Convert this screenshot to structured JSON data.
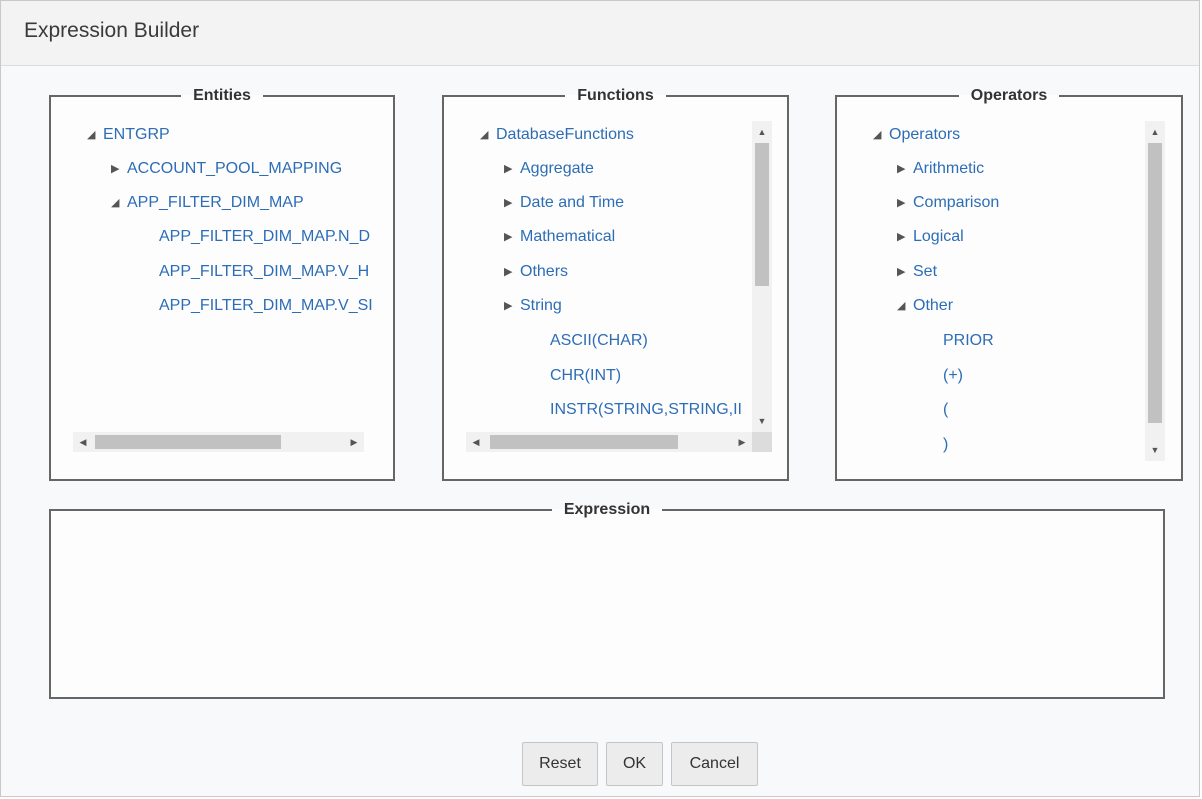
{
  "dialog": {
    "title": "Expression Builder"
  },
  "entities": {
    "legend": "Entities",
    "nodes": [
      {
        "label": "ENTGRP",
        "state": "open"
      },
      {
        "label": "ACCOUNT_POOL_MAPPING",
        "state": "closed"
      },
      {
        "label": "APP_FILTER_DIM_MAP",
        "state": "open"
      },
      {
        "label": "APP_FILTER_DIM_MAP.N_D"
      },
      {
        "label": "APP_FILTER_DIM_MAP.V_H"
      },
      {
        "label": "APP_FILTER_DIM_MAP.V_SI"
      }
    ]
  },
  "functions": {
    "legend": "Functions",
    "nodes": [
      {
        "label": "DatabaseFunctions",
        "state": "open"
      },
      {
        "label": "Aggregate",
        "state": "closed"
      },
      {
        "label": "Date and Time",
        "state": "closed"
      },
      {
        "label": "Mathematical",
        "state": "closed"
      },
      {
        "label": "Others",
        "state": "closed"
      },
      {
        "label": "String",
        "state": "closed"
      },
      {
        "label": "ASCII(CHAR)"
      },
      {
        "label": "CHR(INT)"
      },
      {
        "label": "INSTR(STRING,STRING,II"
      }
    ]
  },
  "operators": {
    "legend": "Operators",
    "nodes": [
      {
        "label": "Operators",
        "state": "open"
      },
      {
        "label": "Arithmetic",
        "state": "closed"
      },
      {
        "label": "Comparison",
        "state": "closed"
      },
      {
        "label": "Logical",
        "state": "closed"
      },
      {
        "label": "Set",
        "state": "closed"
      },
      {
        "label": "Other",
        "state": "open"
      },
      {
        "label": "PRIOR"
      },
      {
        "label": "(+)"
      },
      {
        "label": "("
      },
      {
        "label": ")"
      }
    ]
  },
  "expression": {
    "legend": "Expression",
    "value": ""
  },
  "buttons": {
    "reset": "Reset",
    "ok": "OK",
    "cancel": "Cancel"
  },
  "icons": {
    "expanded": "triangle-down-right-icon",
    "collapsed": "triangle-right-icon"
  }
}
